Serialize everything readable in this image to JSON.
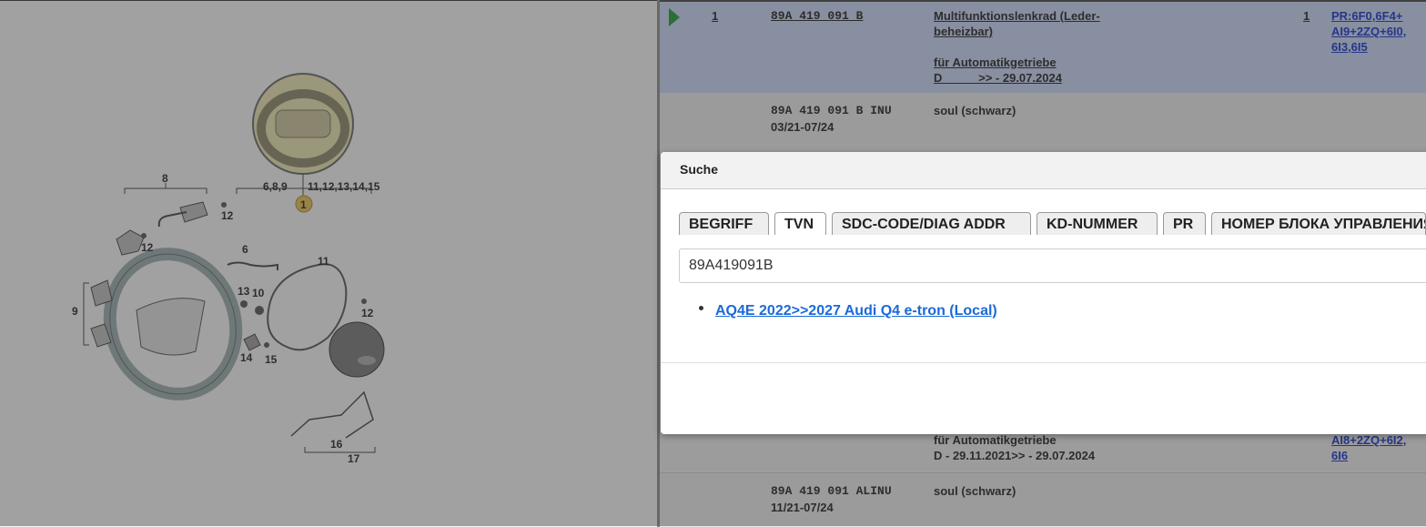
{
  "diagram": {
    "callouts": {
      "c8": "8",
      "c689": "6,8,9",
      "c11": "11,12,13,14,15",
      "c1": "1",
      "c12a": "12",
      "c12b": "12",
      "c6": "6",
      "c11b": "11",
      "c13": "13",
      "c10": "10",
      "c9": "9",
      "c12c": "12",
      "c14": "14",
      "c15": "15",
      "c16": "16",
      "c17": "17"
    }
  },
  "parts": {
    "row1": {
      "pos": "1",
      "part_no": "89A 419 091 B",
      "desc_line1": "Multifunktionslenkrad (Leder-",
      "desc_line2": "beheizbar)",
      "desc_line3": "für Automatikgetriebe",
      "desc_line4": "D           >> - 29.07.2024",
      "qty": "1",
      "pr_line1": "PR:6F0,6F4+",
      "pr_line2": "AI9+2ZQ+6I0,",
      "pr_line3": "6I3,6I5"
    },
    "row2": {
      "part_no": "89A 419 091 B INU",
      "date": "03/21-07/24",
      "desc": "soul (schwarz)"
    },
    "row3": {
      "desc_line1": "für Automatikgetriebe",
      "desc_line2": "D - 29.11.2021>> - 29.07.2024",
      "pr_line1": "AI8+2ZQ+6I2,",
      "pr_line2": "6I6"
    },
    "row4": {
      "part_no": "89A 419 091 ALINU",
      "date": "11/21-07/24",
      "desc": "soul (schwarz)"
    }
  },
  "modal": {
    "title": "Suche",
    "tabs": [
      "BEGRIFF",
      "TVN",
      "SDC-CODE/DIAG ADDR",
      "KD-NUMMER",
      "PR",
      "НОМЕР БЛОКА УПРАВЛЕНИЯ"
    ],
    "active_tab": "TVN",
    "search_value": "89A419091B",
    "result": "AQ4E 2022>>2027 Audi Q4 e-tron (Local)"
  },
  "colors": {
    "selected_row": "#c6d4f2",
    "link": "#1a6ad8",
    "overlay": "rgba(60,60,60,0.45)"
  }
}
